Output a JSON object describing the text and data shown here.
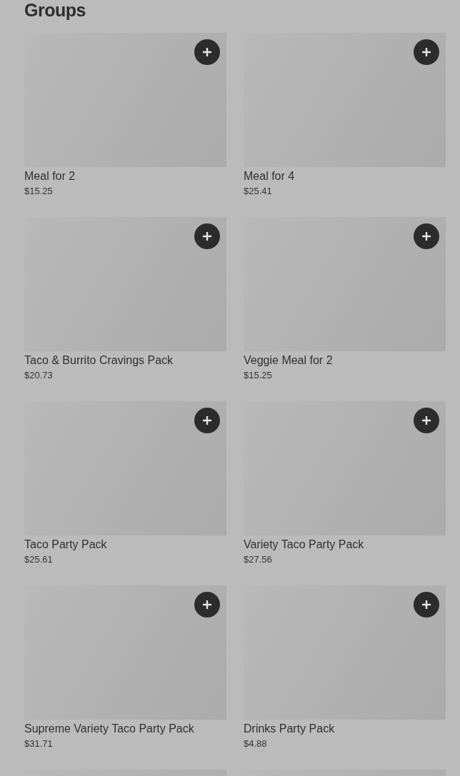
{
  "title": "Groups",
  "items": [
    {
      "name": "Meal for 2",
      "price": "$15.25"
    },
    {
      "name": "Meal for 4",
      "price": "$25.41"
    },
    {
      "name": "Taco & Burrito Cravings Pack",
      "price": "$20.73"
    },
    {
      "name": "Veggie Meal for 2",
      "price": "$15.25"
    },
    {
      "name": "Taco Party Pack",
      "price": "$25.61"
    },
    {
      "name": "Variety Taco Party Pack",
      "price": "$27.56"
    },
    {
      "name": "Supreme Variety Taco Party Pack",
      "price": "$31.71"
    },
    {
      "name": "Drinks Party Pack",
      "price": "$4.88"
    }
  ]
}
